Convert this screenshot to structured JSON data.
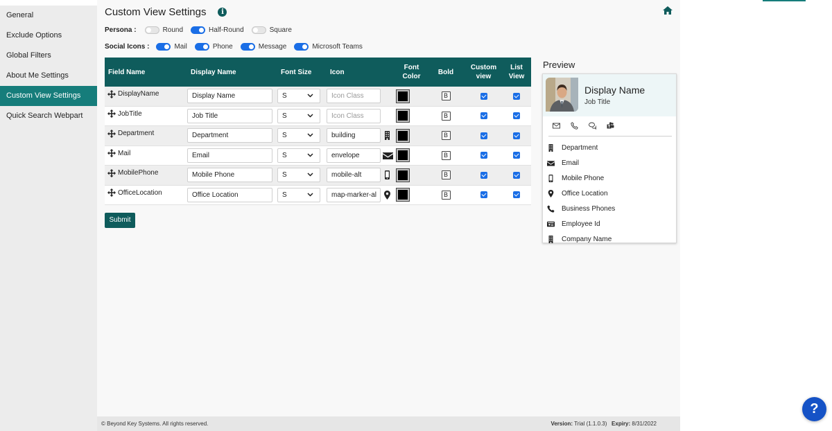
{
  "sidebar": {
    "items": [
      {
        "label": "General"
      },
      {
        "label": "Exclude Options"
      },
      {
        "label": "Global Filters"
      },
      {
        "label": "About Me Settings"
      },
      {
        "label": "Custom View Settings",
        "active": true
      },
      {
        "label": "Quick Search Webpart"
      }
    ]
  },
  "page": {
    "title": "Custom View Settings"
  },
  "persona": {
    "label": "Persona :",
    "options": [
      {
        "label": "Round",
        "on": false
      },
      {
        "label": "Half-Round",
        "on": true
      },
      {
        "label": "Square",
        "on": false
      }
    ]
  },
  "social_icons": {
    "label": "Social Icons :",
    "options": [
      {
        "label": "Mail",
        "on": true
      },
      {
        "label": "Phone",
        "on": true
      },
      {
        "label": "Message",
        "on": true
      },
      {
        "label": "Microsoft Teams",
        "on": true
      }
    ]
  },
  "table": {
    "headers": {
      "field_name": "Field Name",
      "display_name": "Display Name",
      "font_size": "Font Size",
      "icon": "Icon",
      "font_color_1": "Font",
      "font_color_2": "Color",
      "bold": "Bold",
      "custom_view_1": "Custom",
      "custom_view_2": "view",
      "list_view_1": "List",
      "list_view_2": "View"
    },
    "rows": [
      {
        "field": "DisplayName",
        "display": "Display Name",
        "size": "S",
        "icon_value": "",
        "icon_placeholder": "Icon Class",
        "icon_name": "",
        "bold": "B",
        "font_color": "#000000"
      },
      {
        "field": "JobTitle",
        "display": "Job Title",
        "size": "S",
        "icon_value": "",
        "icon_placeholder": "Icon Class",
        "icon_name": "",
        "bold": "B",
        "font_color": "#000000"
      },
      {
        "field": "Department",
        "display": "Department",
        "size": "S",
        "icon_value": "building",
        "icon_placeholder": "",
        "icon_name": "building-icon",
        "bold": "B",
        "font_color": "#000000"
      },
      {
        "field": "Mail",
        "display": "Email",
        "size": "S",
        "icon_value": "envelope",
        "icon_placeholder": "",
        "icon_name": "envelope-icon",
        "bold": "B",
        "font_color": "#000000"
      },
      {
        "field": "MobilePhone",
        "display": "Mobile Phone",
        "size": "S",
        "icon_value": "mobile-alt",
        "icon_placeholder": "",
        "icon_name": "mobile-icon",
        "bold": "B",
        "font_color": "#000000"
      },
      {
        "field": "OfficeLocation",
        "display": "Office Location",
        "size": "S",
        "icon_value": "map-marker-al",
        "icon_placeholder": "",
        "icon_name": "map-marker-icon",
        "bold": "B",
        "font_color": "#000000"
      }
    ]
  },
  "submit_label": "Submit",
  "preview": {
    "title": "Preview",
    "name": "Display Name",
    "job": "Job Title",
    "items": [
      {
        "label": "Department",
        "icon": "building-icon"
      },
      {
        "label": "Email",
        "icon": "envelope-icon"
      },
      {
        "label": "Mobile Phone",
        "icon": "mobile-icon"
      },
      {
        "label": "Office Location",
        "icon": "map-marker-icon"
      },
      {
        "label": "Business Phones",
        "icon": "phone-icon"
      },
      {
        "label": "Employee Id",
        "icon": "id-card-icon"
      },
      {
        "label": "Company Name",
        "icon": "building-icon"
      }
    ]
  },
  "footer": {
    "copyright": "© Beyond Key Systems. All rights reserved.",
    "version_label": "Version:",
    "version_value": "Trial (1.1.0.3)",
    "expiry_label": "Expiry:",
    "expiry_value": "8/31/2022"
  },
  "help_label": "?",
  "info_label": "i",
  "colors": {
    "accent": "#0f5c5c",
    "active_nav": "#167d7b",
    "toggle_on": "#1a6ee6",
    "help": "#1552c6"
  }
}
